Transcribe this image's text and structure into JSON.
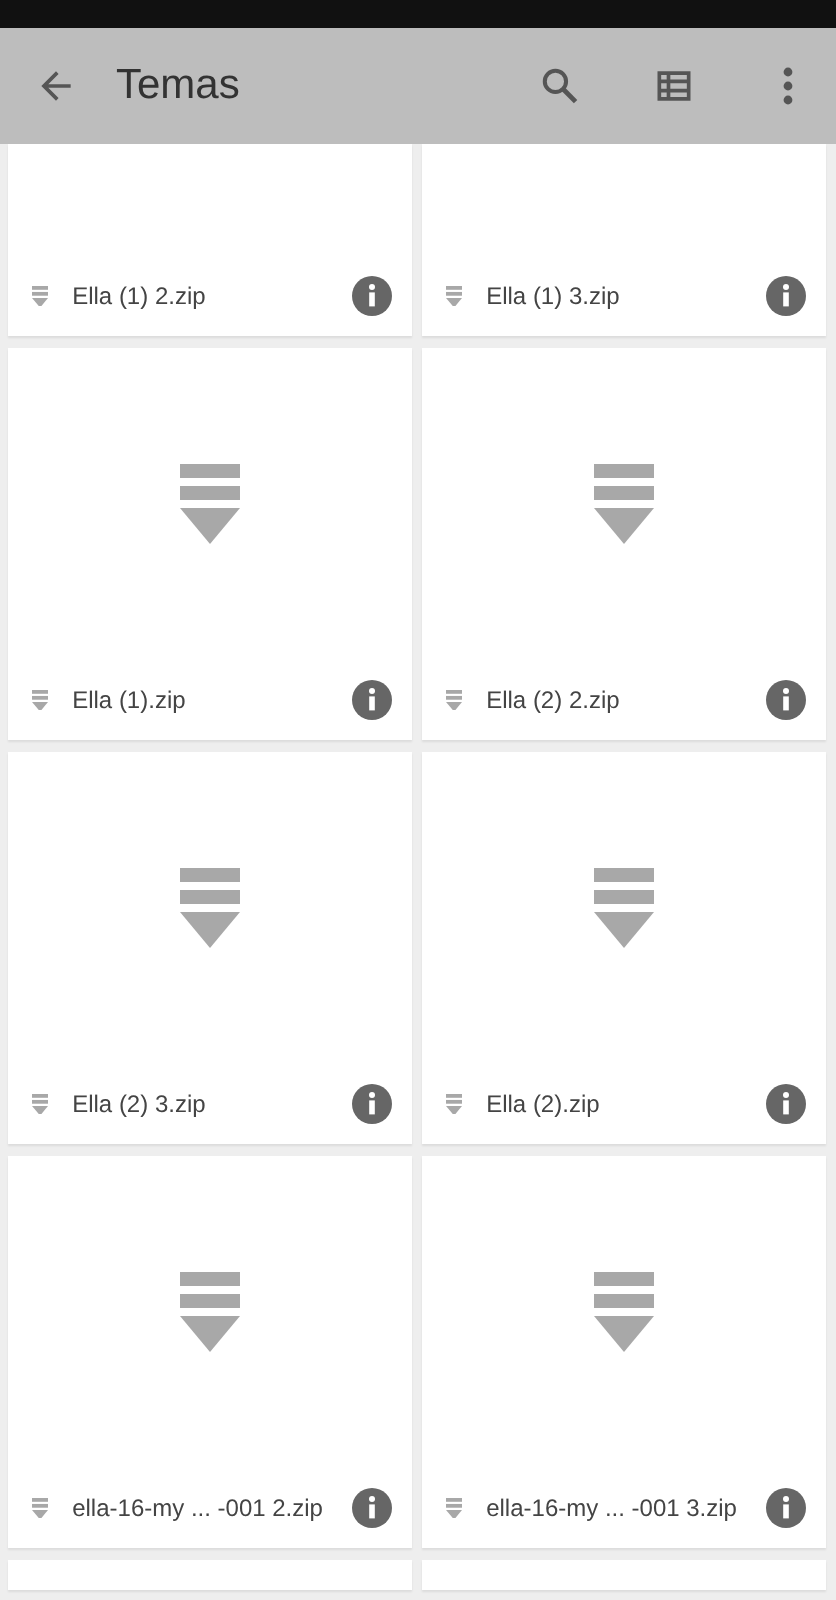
{
  "toolbar": {
    "title": "Temas"
  },
  "files": [
    {
      "name": "Ella (1) 2.zip",
      "kind": "cut"
    },
    {
      "name": "Ella (1) 3.zip",
      "kind": "cut"
    },
    {
      "name": "Ella (1).zip",
      "kind": "full"
    },
    {
      "name": "Ella (2) 2.zip",
      "kind": "full"
    },
    {
      "name": "Ella (2) 3.zip",
      "kind": "full"
    },
    {
      "name": "Ella (2).zip",
      "kind": "full"
    },
    {
      "name": "ella-16-my ... -001 2.zip",
      "kind": "full"
    },
    {
      "name": "ella-16-my ... -001 3.zip",
      "kind": "full"
    }
  ]
}
